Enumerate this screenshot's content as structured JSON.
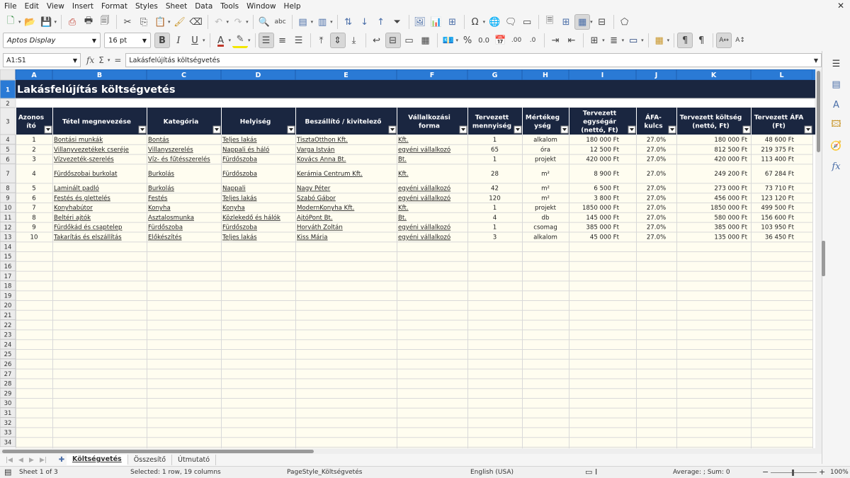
{
  "menu": [
    "File",
    "Edit",
    "View",
    "Insert",
    "Format",
    "Styles",
    "Sheet",
    "Data",
    "Tools",
    "Window",
    "Help"
  ],
  "toolbar": {
    "font_name": "Aptos Display",
    "font_size": "16 pt",
    "bold": "B",
    "italic": "I",
    "underline": "U"
  },
  "formula_bar": {
    "cell_ref": "A1:S1",
    "content": "Lakásfelújítás költségvetés"
  },
  "sheet": {
    "columns": [
      "A",
      "B",
      "C",
      "D",
      "E",
      "F",
      "G",
      "H",
      "I",
      "J",
      "K",
      "L"
    ],
    "title": "Lakásfelújítás költségvetés",
    "headers": [
      [
        "Azonos",
        "ító"
      ],
      [
        "Tétel megnevezése"
      ],
      [
        "Kategória"
      ],
      [
        "Helyiség"
      ],
      [
        "Beszállító / kivitelező"
      ],
      [
        "Vállalkozási",
        "forma"
      ],
      [
        "Tervezett",
        "mennyiség"
      ],
      [
        "Mértékeg",
        "ység"
      ],
      [
        "Tervezett",
        "egységár",
        "(nettó, Ft)"
      ],
      [
        "ÁFA-",
        "kulcs"
      ],
      [
        "Tervezett költség",
        "(nettó, Ft)"
      ],
      [
        "Tervezett ÁFA",
        "(Ft)"
      ]
    ],
    "rows": [
      [
        "1",
        "Bontási munkák",
        "Bontás",
        "Teljes lakás",
        "TisztaOtthon Kft.",
        "Kft.",
        "1",
        "alkalom",
        "180 000 Ft",
        "27.0%",
        "180 000 Ft",
        "48 600 Ft"
      ],
      [
        "2",
        "Villanyvezetékek cseréje",
        "Villanyszerelés",
        "Nappali és háló",
        "Varga István",
        "egyéni vállalkozó",
        "65",
        "óra",
        "12 500 Ft",
        "27.0%",
        "812 500 Ft",
        "219 375 Ft"
      ],
      [
        "3",
        "Vízvezeték-szerelés",
        "Víz- és fűtésszerelés",
        "Fürdőszoba",
        "Kovács Anna Bt.",
        "Bt.",
        "1",
        "projekt",
        "420 000 Ft",
        "27.0%",
        "420 000 Ft",
        "113 400 Ft"
      ],
      [
        "4",
        "Fürdőszobai burkolat",
        "Burkolás",
        "Fürdőszoba",
        "Kerámia Centrum Kft.",
        "Kft.",
        "28",
        "m²",
        "8 900 Ft",
        "27.0%",
        "249 200 Ft",
        "67 284 Ft"
      ],
      [
        "5",
        "Laminált padló",
        "Burkolás",
        "Nappali",
        "Nagy Péter",
        "egyéni vállalkozó",
        "42",
        "m²",
        "6 500 Ft",
        "27.0%",
        "273 000 Ft",
        "73 710 Ft"
      ],
      [
        "6",
        "Festés és glettelés",
        "Festés",
        "Teljes lakás",
        "Szabó Gábor",
        "egyéni vállalkozó",
        "120",
        "m²",
        "3 800 Ft",
        "27.0%",
        "456 000 Ft",
        "123 120 Ft"
      ],
      [
        "7",
        "Konyhabútor",
        "Konyha",
        "Konyha",
        "ModernKonyha Kft.",
        "Kft.",
        "1",
        "projekt",
        "1850 000 Ft",
        "27.0%",
        "1850 000 Ft",
        "499 500 Ft"
      ],
      [
        "8",
        "Beltéri ajtók",
        "Asztalosmunka",
        "Közlekedő és hálók",
        "AjtóPont Bt.",
        "Bt.",
        "4",
        "db",
        "145 000 Ft",
        "27.0%",
        "580 000 Ft",
        "156 600 Ft"
      ],
      [
        "9",
        "Fürdőkád és csaptelep",
        "Fürdőszoba",
        "Fürdőszoba",
        "Horváth Zoltán",
        "egyéni vállalkozó",
        "1",
        "csomag",
        "385 000 Ft",
        "27.0%",
        "385 000 Ft",
        "103 950 Ft"
      ],
      [
        "10",
        "Takarítás és elszállítás",
        "Előkészítés",
        "Teljes lakás",
        "Kiss Mária",
        "egyéni vállalkozó",
        "3",
        "alkalom",
        "45 000 Ft",
        "27.0%",
        "135 000 Ft",
        "36 450 Ft"
      ]
    ],
    "row_numbers": [
      "1",
      "2",
      "3",
      "4",
      "5",
      "6",
      "7",
      "8",
      "9",
      "10",
      "11",
      "12",
      "13",
      "14",
      "15",
      "16",
      "17",
      "18",
      "19",
      "20",
      "21",
      "22",
      "23",
      "24",
      "25",
      "26",
      "27",
      "28",
      "29",
      "30",
      "31",
      "32",
      "33",
      "34"
    ]
  },
  "tabs": [
    "Költségvetés",
    "Összesítő",
    "Útmutató"
  ],
  "status": {
    "sheet": "Sheet 1 of 3",
    "selection": "Selected: 1 row, 19 columns",
    "page_style": "PageStyle_Költségvetés",
    "language": "English (USA)",
    "aggregate": "Average: ; Sum: 0",
    "zoom": "100%"
  },
  "colors": {
    "header_fill": "#1a2640",
    "header_text": "#ffffff",
    "column_header_selected": "#2a7ad5",
    "body_fill": "#fffdf0",
    "grid_line": "#d9d9d9"
  }
}
